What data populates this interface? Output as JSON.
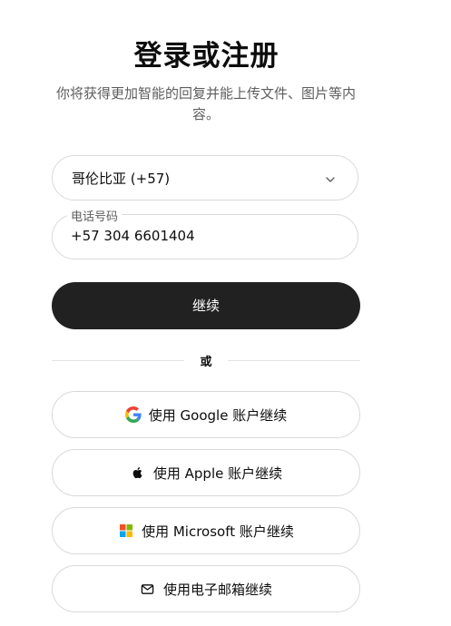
{
  "header": {
    "title": "登录或注册",
    "subtitle": "你将获得更加智能的回复并能上传文件、图片等内容。"
  },
  "form": {
    "country_value": "哥伦比亚 (+57)",
    "phone_label": "电话号码",
    "phone_value": "+57 304 6601404",
    "continue_label": "继续"
  },
  "divider": {
    "label": "或"
  },
  "social": {
    "google_label": "使用 Google 账户继续",
    "apple_label": "使用 Apple 账户继续",
    "microsoft_label": "使用 Microsoft 账户继续",
    "email_label": "使用电子邮箱继续"
  },
  "icons": {
    "google": "google-icon",
    "apple": "apple-icon",
    "microsoft": "microsoft-icon",
    "email": "mail-icon",
    "chevron": "chevron-down-icon"
  },
  "colors": {
    "primary_button": "#212121",
    "border": "#d9d9d9",
    "muted_text": "#5d5d5d",
    "ms_red": "#f25022",
    "ms_green": "#7fba00",
    "ms_blue": "#00a4ef",
    "ms_yellow": "#ffb900"
  }
}
